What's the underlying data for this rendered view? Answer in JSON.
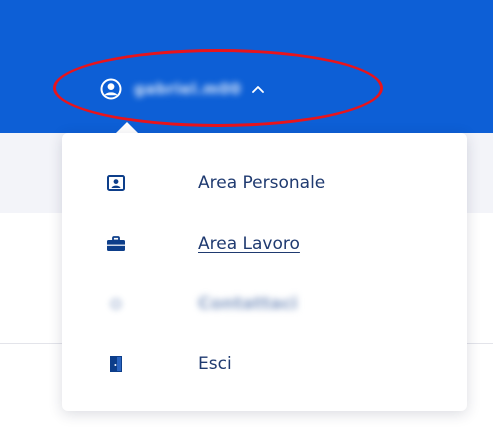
{
  "header": {
    "username": "gabriel.m00",
    "user_icon": "user-circle-icon",
    "toggle_icon": "chevron-up-icon",
    "background_color": "#0d5fd6"
  },
  "annotation": {
    "shape": "ellipse",
    "color": "#e8141c"
  },
  "menu": {
    "items": [
      {
        "label": "Area Personale",
        "icon": "id-card-icon",
        "underlined": false,
        "blurred": false
      },
      {
        "label": "Area Lavoro",
        "icon": "briefcase-icon",
        "underlined": true,
        "blurred": false
      },
      {
        "label": "Contattaci",
        "icon": "gear-icon",
        "underlined": false,
        "blurred": true
      },
      {
        "label": "Esci",
        "icon": "door-exit-icon",
        "underlined": false,
        "blurred": false
      }
    ],
    "text_color": "#1f3a70",
    "icon_color": "#0d3e8a"
  }
}
